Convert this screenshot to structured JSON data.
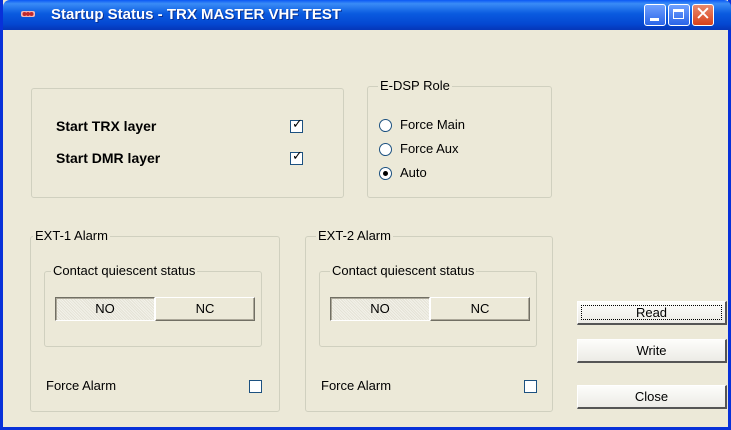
{
  "window": {
    "title": "Startup Status - TRX MASTER VHF TEST",
    "icon": "app-icon",
    "controls": [
      "minimize-icon",
      "maximize-icon",
      "close-icon"
    ]
  },
  "layers": {
    "start_trx_label": "Start TRX layer",
    "start_trx_checked": true,
    "start_dmr_label": "Start DMR layer",
    "start_dmr_checked": true
  },
  "edsp_role": {
    "legend": "E-DSP Role",
    "options": [
      {
        "label": "Force Main",
        "selected": false
      },
      {
        "label": "Force Aux",
        "selected": false
      },
      {
        "label": "Auto",
        "selected": true
      }
    ]
  },
  "ext1": {
    "legend": "EXT-1 Alarm",
    "contact_legend": "Contact quiescent status",
    "no_label": "NO",
    "nc_label": "NC",
    "selected": "NO",
    "force_alarm_label": "Force Alarm",
    "force_alarm_checked": false
  },
  "ext2": {
    "legend": "EXT-2 Alarm",
    "contact_legend": "Contact quiescent status",
    "no_label": "NO",
    "nc_label": "NC",
    "selected": "NO",
    "force_alarm_label": "Force Alarm",
    "force_alarm_checked": false
  },
  "buttons": {
    "read": "Read",
    "write": "Write",
    "close": "Close"
  },
  "colors": {
    "titlebar": "#0a5be0",
    "face": "#ece9d8",
    "close_button": "#d9411b"
  }
}
